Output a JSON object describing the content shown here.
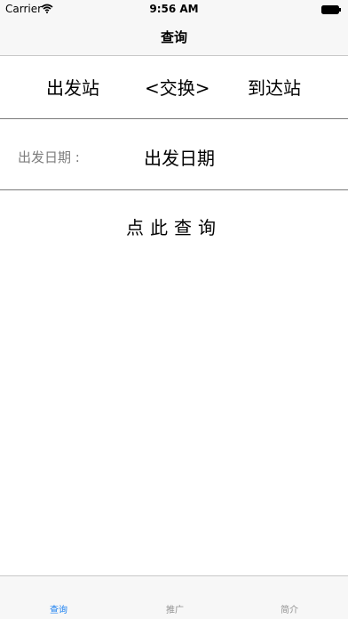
{
  "status_bar": {
    "carrier": "Carrier",
    "time": "9:56 AM",
    "icons": [
      "wifi-icon",
      "battery-icon"
    ]
  },
  "nav": {
    "title": "查询"
  },
  "stations": {
    "depart": "出发站",
    "swap": "<交换>",
    "arrive": "到达站"
  },
  "date": {
    "label": "出发日期 :",
    "value": "出发日期"
  },
  "query": {
    "label": "点此查询"
  },
  "tabs": [
    {
      "label": "查询",
      "active": true
    },
    {
      "label": "推广",
      "active": false
    },
    {
      "label": "简介",
      "active": false
    }
  ],
  "colors": {
    "accent": "#1a7ff0",
    "divider": "#7a7a7a",
    "secondary_text": "#7d7d7d",
    "bar_background": "#f7f7f7"
  }
}
